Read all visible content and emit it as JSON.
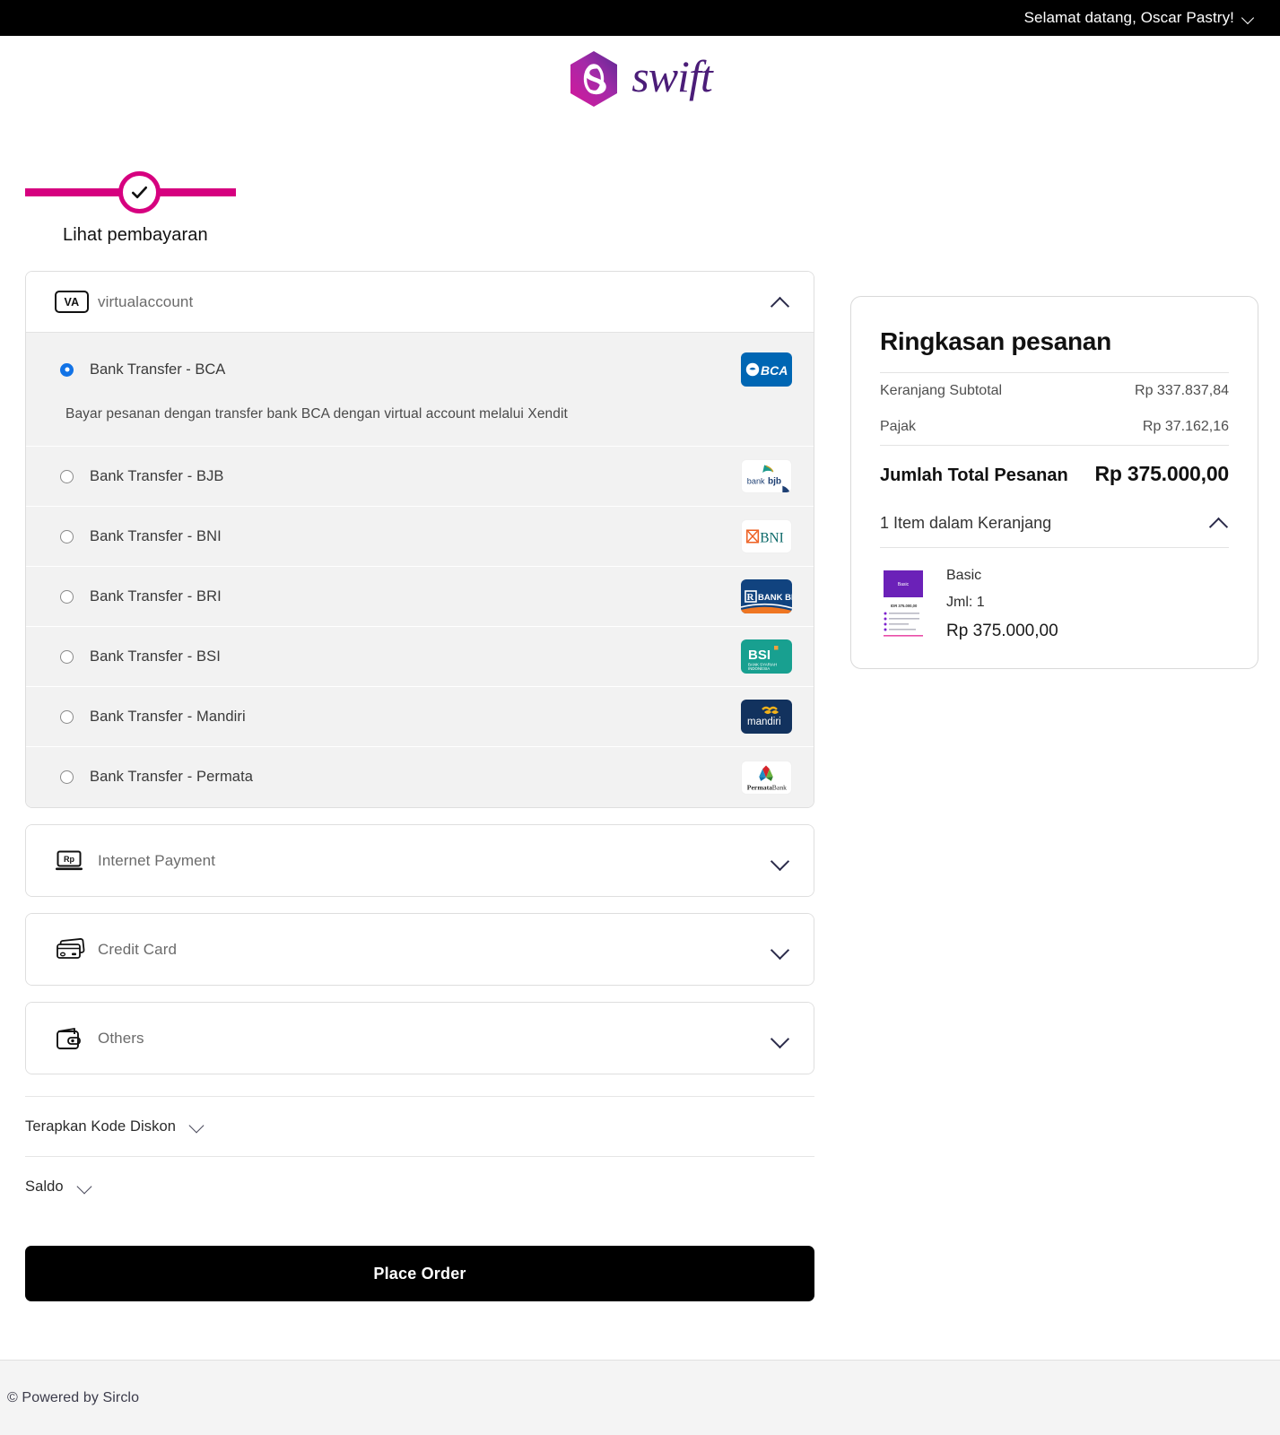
{
  "topbar": {
    "greeting": "Selamat datang, Oscar Pastry!"
  },
  "brand": {
    "name": "swift"
  },
  "stepper": {
    "label": "Lihat pembayaran"
  },
  "payment_groups": [
    {
      "key": "virtualaccount",
      "title": "virtualaccount",
      "icon": "va-badge-icon",
      "expanded": true
    },
    {
      "key": "internet_payment",
      "title": "Internet Payment",
      "icon": "laptop-rp-icon",
      "expanded": false
    },
    {
      "key": "credit_card",
      "title": "Credit Card",
      "icon": "credit-card-icon",
      "expanded": false
    },
    {
      "key": "others",
      "title": "Others",
      "icon": "wallet-icon",
      "expanded": false
    }
  ],
  "va_options": [
    {
      "label": "Bank Transfer - BCA",
      "selected": true,
      "logo": "bca",
      "description": "Bayar pesanan dengan transfer bank BCA dengan virtual account melalui Xendit"
    },
    {
      "label": "Bank Transfer - BJB",
      "selected": false,
      "logo": "bjb"
    },
    {
      "label": "Bank Transfer - BNI",
      "selected": false,
      "logo": "bni"
    },
    {
      "label": "Bank Transfer - BRI",
      "selected": false,
      "logo": "bri"
    },
    {
      "label": "Bank Transfer - BSI",
      "selected": false,
      "logo": "bsi"
    },
    {
      "label": "Bank Transfer - Mandiri",
      "selected": false,
      "logo": "mandiri"
    },
    {
      "label": "Bank Transfer - Permata",
      "selected": false,
      "logo": "permata"
    }
  ],
  "bank_logo_text": {
    "bca": "BCA",
    "bjb_prefix": "bank ",
    "bjb_bold": "bjb",
    "bni": "BNI",
    "bri": "BANK BRI",
    "bsi": "BSI",
    "bsi_sub1": "BANK SYARIAH",
    "bsi_sub2": "INDONESIA",
    "mandiri": "mandiri",
    "permata_a": "Permata",
    "permata_b": "Bank"
  },
  "va_icon_label": "VA",
  "rp_icon_label": "Rp",
  "extras": {
    "discount_label": "Terapkan Kode Diskon",
    "saldo_label": "Saldo"
  },
  "place_order_label": "Place Order",
  "summary": {
    "title": "Ringkasan pesanan",
    "rows": [
      {
        "label": "Keranjang Subtotal",
        "value": "Rp 337.837,84"
      },
      {
        "label": "Pajak",
        "value": "Rp 37.162,16"
      }
    ],
    "total_label": "Jumlah Total Pesanan",
    "total_value": "Rp 375.000,00",
    "items_header": "1 Item dalam Keranjang",
    "items": [
      {
        "name": "Basic",
        "qty_label": "Jml: 1",
        "price": "Rp 375.000,00",
        "thumb_title": "Basic",
        "thumb_price": "IDR 375.000,00"
      }
    ]
  },
  "footer": {
    "text": "© Powered by Sirclo"
  },
  "colors": {
    "accent_magenta": "#d6007f",
    "brand_purple": "#4b1d78",
    "radio_blue": "#1273e6",
    "bca_blue": "#0066b3",
    "bri_blue": "#11437f",
    "bsi_teal": "#18a090",
    "mandiri_navy": "#12325e",
    "button_black": "#000000"
  }
}
